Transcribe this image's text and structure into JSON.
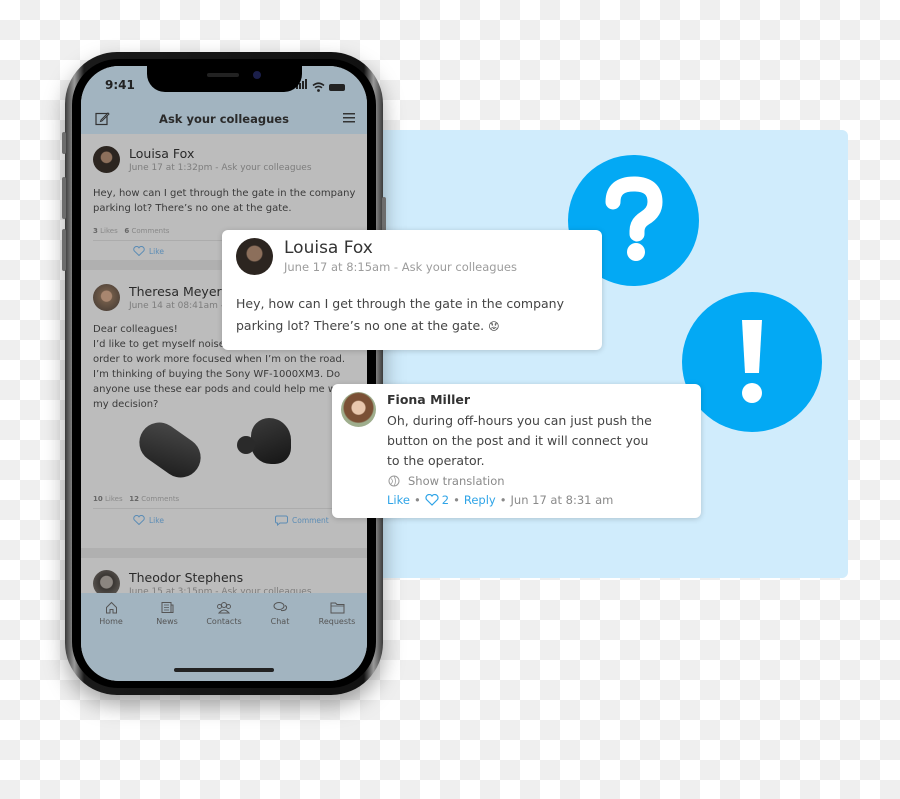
{
  "phone": {
    "status_bar": {
      "time": "9:41"
    },
    "header": {
      "title": "Ask your colleagues",
      "left_icon": "compose-icon",
      "right_icon": "menu-icon"
    },
    "posts": [
      {
        "author": "Louisa Fox",
        "meta": "June 17 at 1:32pm - Ask your colleagues",
        "body_lines": [
          "Hey, how can I get through the gate in the company",
          "parking lot? There’s no one at the gate."
        ],
        "likes_count": "3",
        "likes_label": "Likes",
        "comments_count": "6",
        "comments_label": "Comments",
        "like_action": "Like"
      },
      {
        "author": "Theresa Meyer",
        "meta": "June 14 at 08:41am - Ask your colleagues",
        "body_lines": [
          "Dear colleagues!",
          "I’d like to get myself noise-cancelling ear pods in",
          "order to work more focused when I’m on the road.",
          "I’m thinking of buying the Sony WF-1000XM3. Do",
          "anyone use these ear pods and could help me with",
          "my decision?"
        ],
        "image": "earbuds-photo",
        "likes_count": "10",
        "likes_label": "Likes",
        "comments_count": "12",
        "comments_label": "Comments",
        "like_action": "Like",
        "comment_action": "Comment"
      },
      {
        "author": "Theodor Stephens",
        "meta": "June 15 at 3:15pm - Ask your colleagues"
      }
    ],
    "tabs": [
      {
        "label": "Home",
        "icon": "home-icon"
      },
      {
        "label": "News",
        "icon": "news-icon"
      },
      {
        "label": "Contacts",
        "icon": "contacts-icon"
      },
      {
        "label": "Chat",
        "icon": "chat-icon"
      },
      {
        "label": "Requests",
        "icon": "folder-icon"
      }
    ]
  },
  "question_card": {
    "author": "Louisa Fox",
    "meta": "June 17 at 8:15am - Ask your colleagues",
    "body_lines": [
      "Hey, how can I get through the gate in the company",
      "parking lot? There’s no one at the gate."
    ],
    "emoji": "😟"
  },
  "answer_card": {
    "author": "Fiona Miller",
    "body_lines": [
      "Oh, during off-hours you can just push the",
      "button on the post and it will connect you",
      "to the operator."
    ],
    "translation_label": "Show translation",
    "like_label": "Like",
    "separator": "•",
    "heart_count": "2",
    "reply_label": "Reply",
    "timestamp": "Jun 17 at 8:31 am"
  },
  "badges": {
    "question_icon": "question-mark-icon",
    "exclamation_icon": "exclamation-mark-icon"
  },
  "colors": {
    "accent_blue": "#03a9f4",
    "panel_blue": "#d0ecfc",
    "link_blue": "#2fa4e7",
    "app_chrome": "#a2b4c0"
  }
}
